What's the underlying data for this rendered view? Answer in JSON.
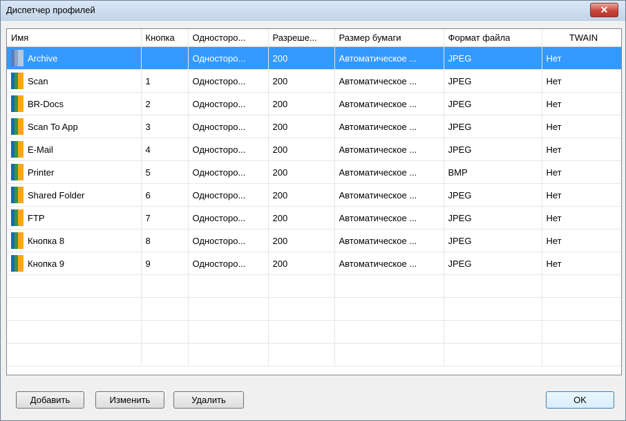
{
  "window": {
    "title": "Диспетчер профилей",
    "close_glyph": "✕"
  },
  "columns": [
    "Имя",
    "Кнопка",
    "Одностoро...",
    "Разреше...",
    "Размер бумаги",
    "Формат файла",
    "TWAIN"
  ],
  "rows": [
    {
      "name": "Archive",
      "button": "",
      "sides": "Одностoро...",
      "resolution": "200",
      "paper": "Автоматическое ...",
      "format": "JPEG",
      "twain": "Нет",
      "icon": "archive-profile-icon",
      "selected": true
    },
    {
      "name": "Scan",
      "button": "1",
      "sides": "Одностoро...",
      "resolution": "200",
      "paper": "Автоматическое ...",
      "format": "JPEG",
      "twain": "Нет",
      "icon": "profile-icon"
    },
    {
      "name": "BR-Docs",
      "button": "2",
      "sides": "Одностoро...",
      "resolution": "200",
      "paper": "Автоматическое ...",
      "format": "JPEG",
      "twain": "Нет",
      "icon": "profile-icon"
    },
    {
      "name": "Scan To App",
      "button": "3",
      "sides": "Одностoро...",
      "resolution": "200",
      "paper": "Автоматическое ...",
      "format": "JPEG",
      "twain": "Нет",
      "icon": "profile-icon"
    },
    {
      "name": "E-Mail",
      "button": "4",
      "sides": "Одностoро...",
      "resolution": "200",
      "paper": "Автоматическое ...",
      "format": "JPEG",
      "twain": "Нет",
      "icon": "profile-icon"
    },
    {
      "name": "Printer",
      "button": "5",
      "sides": "Одностoро...",
      "resolution": "200",
      "paper": "Автоматическое ...",
      "format": "BMP",
      "twain": "Нет",
      "icon": "profile-icon"
    },
    {
      "name": "Shared Folder",
      "button": "6",
      "sides": "Одностoро...",
      "resolution": "200",
      "paper": "Автоматическое ...",
      "format": "JPEG",
      "twain": "Нет",
      "icon": "profile-icon"
    },
    {
      "name": "FTP",
      "button": "7",
      "sides": "Одностoро...",
      "resolution": "200",
      "paper": "Автоматическое ...",
      "format": "JPEG",
      "twain": "Нет",
      "icon": "profile-icon"
    },
    {
      "name": "Кнопка 8",
      "button": "8",
      "sides": "Одностoро...",
      "resolution": "200",
      "paper": "Автоматическое ...",
      "format": "JPEG",
      "twain": "Нет",
      "icon": "profile-icon"
    },
    {
      "name": "Кнопка 9",
      "button": "9",
      "sides": "Одностoро...",
      "resolution": "200",
      "paper": "Автоматическое ...",
      "format": "JPEG",
      "twain": "Нет",
      "icon": "profile-icon"
    }
  ],
  "buttons": {
    "add": "Добавить",
    "edit": "Изменить",
    "delete": "Удалить",
    "ok": "OK"
  },
  "colors": {
    "selection": "#3399ff",
    "close_button": "#c8483c"
  }
}
